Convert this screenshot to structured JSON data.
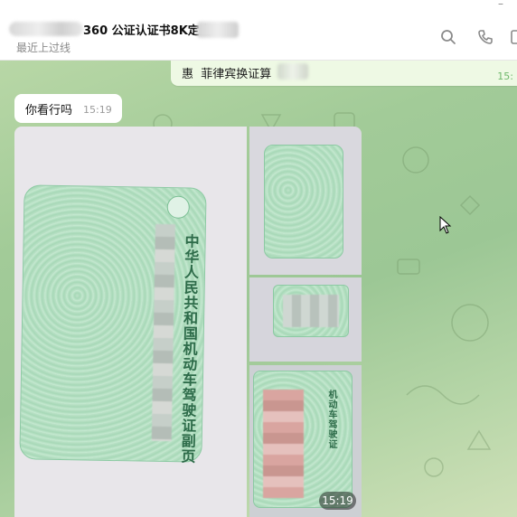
{
  "header": {
    "title": "360 公证认证书8K定金",
    "status": "最近上过线"
  },
  "pinned": {
    "icon_char": "惠",
    "text": "菲律宾换证算",
    "time": "15:"
  },
  "messages": [
    {
      "text": "你看行吗",
      "time": "15:19"
    }
  ],
  "album": {
    "time": "15:19",
    "card_text": "中华人民共和国机动车驾驶证副页",
    "small_card_text": "机动车驾驶证"
  },
  "colors": {
    "pinned_bg": "#eef9e4",
    "pinned_time": "#6fb86c",
    "chat_bg": "#a2cb98"
  }
}
